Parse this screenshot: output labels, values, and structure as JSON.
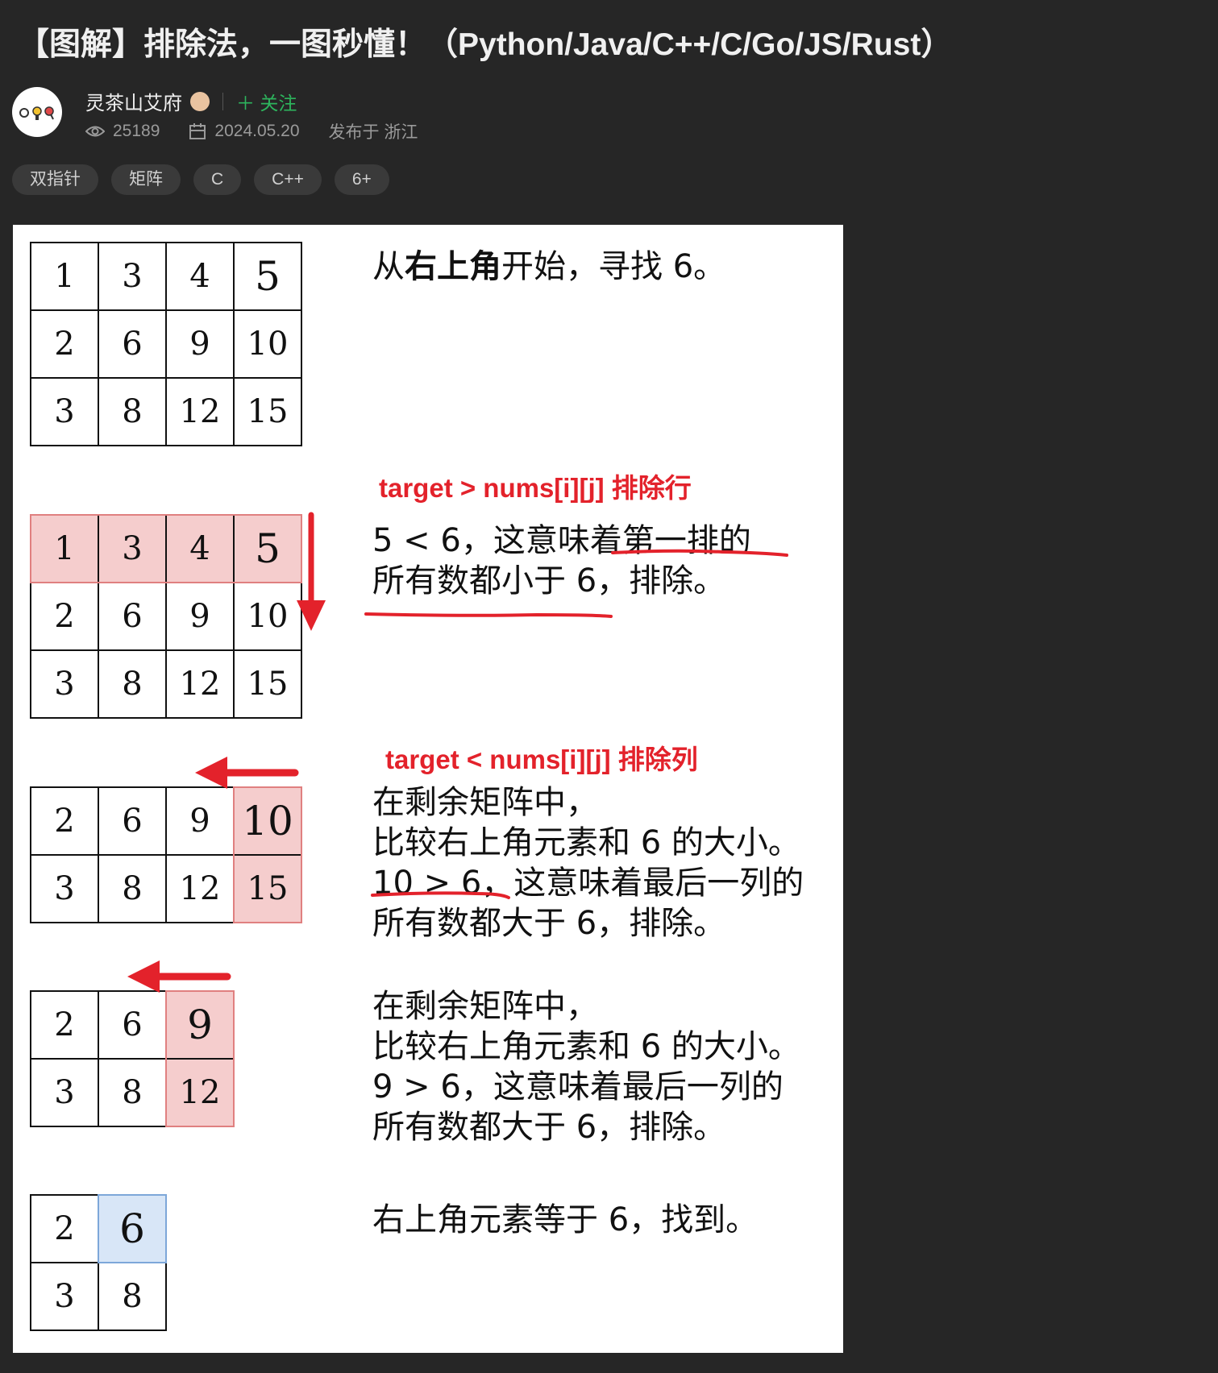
{
  "header": {
    "title": "【图解】排除法，一图秒懂！（Python/Java/C++/C/Go/JS/Rust）"
  },
  "author": {
    "name": "灵茶山艾府",
    "follow_label": "＋ 关注"
  },
  "meta": {
    "views": "25189",
    "date": "2024.05.20",
    "location": "发布于 浙江"
  },
  "tags": [
    "双指针",
    "矩阵",
    "C",
    "C++",
    "6+"
  ],
  "colors": {
    "page_bg": "#262626",
    "follow_green": "#2db55d",
    "red": "#e3222b",
    "highlight_red": "#f5cdcd",
    "highlight_blue": "#d8e6f7"
  },
  "figure": {
    "steps": [
      {
        "matrix": [
          [
            "1",
            "3",
            "4",
            "5"
          ],
          [
            "2",
            "6",
            "9",
            "10"
          ],
          [
            "3",
            "8",
            "12",
            "15"
          ]
        ],
        "highlight": "none",
        "desc": [
          {
            "t": "从"
          },
          {
            "t": "右上角",
            "b": true
          },
          {
            "t": "开始，寻找 6。"
          }
        ]
      },
      {
        "label": "target > nums[i][j]   排除行",
        "matrix": [
          [
            "1",
            "3",
            "4",
            "5"
          ],
          [
            "2",
            "6",
            "9",
            "10"
          ],
          [
            "3",
            "8",
            "12",
            "15"
          ]
        ],
        "highlight": "row0",
        "arrow": "down",
        "desc": [
          "5 < 6，这意味着第一排的",
          "所有数都小于 6，排除。"
        ]
      },
      {
        "label": "target < nums[i][j]   排除列",
        "matrix": [
          [
            "2",
            "6",
            "9",
            "10"
          ],
          [
            "3",
            "8",
            "12",
            "15"
          ]
        ],
        "highlight": "lastcol",
        "arrow": "left",
        "desc": [
          "在剩余矩阵中，",
          "比较右上角元素和 6 的大小。",
          "10 > 6，这意味着最后一列的",
          "所有数都大于 6，排除。"
        ]
      },
      {
        "matrix": [
          [
            "2",
            "6",
            "9"
          ],
          [
            "3",
            "8",
            "12"
          ]
        ],
        "highlight": "lastcol",
        "arrow": "left",
        "desc": [
          "在剩余矩阵中，",
          "比较右上角元素和 6 的大小。",
          "9 > 6，这意味着最后一列的",
          "所有数都大于 6，排除。"
        ]
      },
      {
        "matrix": [
          [
            "2",
            "6"
          ],
          [
            "3",
            "8"
          ]
        ],
        "highlight": "found",
        "desc": [
          "右上角元素等于 6，找到。"
        ]
      }
    ]
  }
}
